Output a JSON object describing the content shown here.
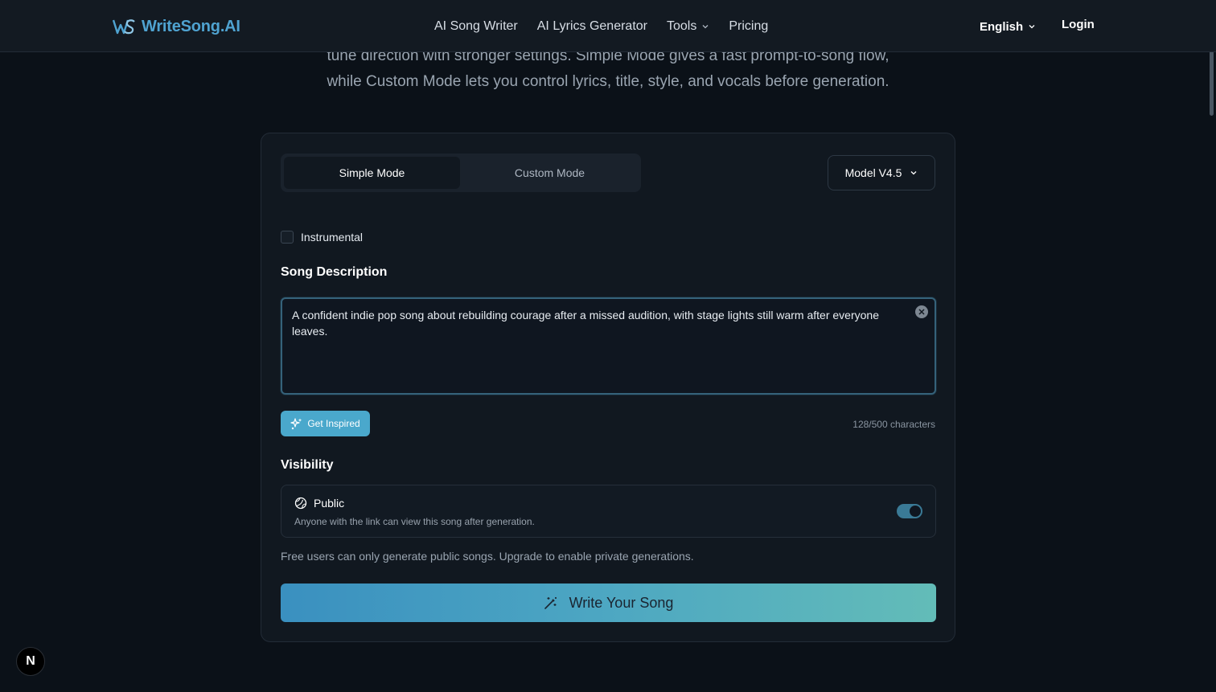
{
  "header": {
    "logo_text": "WriteSong.AI",
    "nav": [
      {
        "label": "AI Song Writer"
      },
      {
        "label": "AI Lyrics Generator"
      },
      {
        "label": "Tools"
      },
      {
        "label": "Pricing"
      }
    ],
    "language": "English",
    "login": "Login"
  },
  "intro": {
    "line1": "tune direction with stronger settings. Simple Mode gives a fast prompt-to-song flow,",
    "line2": "while Custom Mode lets you control lyrics, title, style, and vocals before generation."
  },
  "form": {
    "tabs": [
      {
        "label": "Simple Mode",
        "active": true
      },
      {
        "label": "Custom Mode",
        "active": false
      }
    ],
    "model": "Model V4.5",
    "instrumental_label": "Instrumental",
    "instrumental_checked": false,
    "song_description_label": "Song Description",
    "song_description_value": "A confident indie pop song about rebuilding courage after a missed audition, with stage lights still warm after everyone leaves.",
    "get_inspired": "Get Inspired",
    "char_count": "128/500 characters",
    "visibility_label": "Visibility",
    "visibility_option": "Public",
    "visibility_description": "Anyone with the link can view this song after generation.",
    "visibility_public": true,
    "free_note": "Free users can only generate public songs. Upgrade to enable private generations.",
    "submit": "Write Your Song"
  },
  "badge": "N",
  "colors": {
    "accent": "#4fa3d1",
    "button_gradient_start": "#3a90c0",
    "button_gradient_end": "#63bcb8",
    "background": "#0b1118"
  }
}
